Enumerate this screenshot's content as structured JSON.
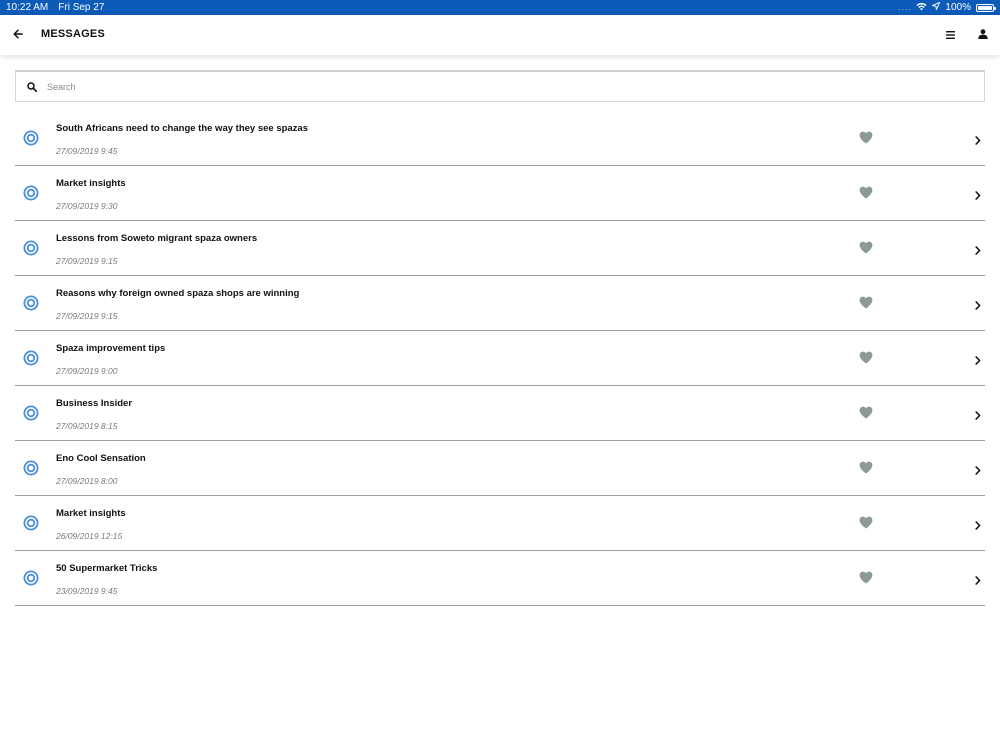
{
  "status_bar": {
    "time": "10:22 AM",
    "date": "Fri Sep 27",
    "signal_dots": "....",
    "battery_text": "100%",
    "battery_level": 1.0,
    "icons": [
      "wifi-icon",
      "location-arrow-icon",
      "battery-icon"
    ],
    "color": "#0d5bb8"
  },
  "header": {
    "title": "MESSAGES",
    "icons": [
      "back-arrow-icon",
      "hamburger-menu-icon",
      "user-icon"
    ]
  },
  "search": {
    "placeholder": "Search",
    "value": "",
    "icon": "search-icon"
  },
  "colors": {
    "target_icon": "#4a8fd8",
    "heart_icon": "#8b9a96",
    "row_divider": "#9e9e9e"
  },
  "messages": [
    {
      "title": "South Africans need to change the way they see spazas",
      "date": "27/09/2019 9:45"
    },
    {
      "title": "Market insights",
      "date": "27/09/2019 9:30"
    },
    {
      "title": "Lessons from Soweto migrant spaza owners",
      "date": "27/09/2019 9:15"
    },
    {
      "title": "Reasons why foreign owned spaza shops are winning",
      "date": "27/09/2019 9:15"
    },
    {
      "title": "Spaza improvement tips",
      "date": "27/09/2019 9:00"
    },
    {
      "title": "Business Insider",
      "date": "27/09/2019 8:15"
    },
    {
      "title": "Eno Cool Sensation",
      "date": "27/09/2019 8:00"
    },
    {
      "title": "Market insights",
      "date": "26/09/2019 12:15"
    },
    {
      "title": "50 Supermarket Tricks",
      "date": "23/09/2019 9:45"
    }
  ]
}
